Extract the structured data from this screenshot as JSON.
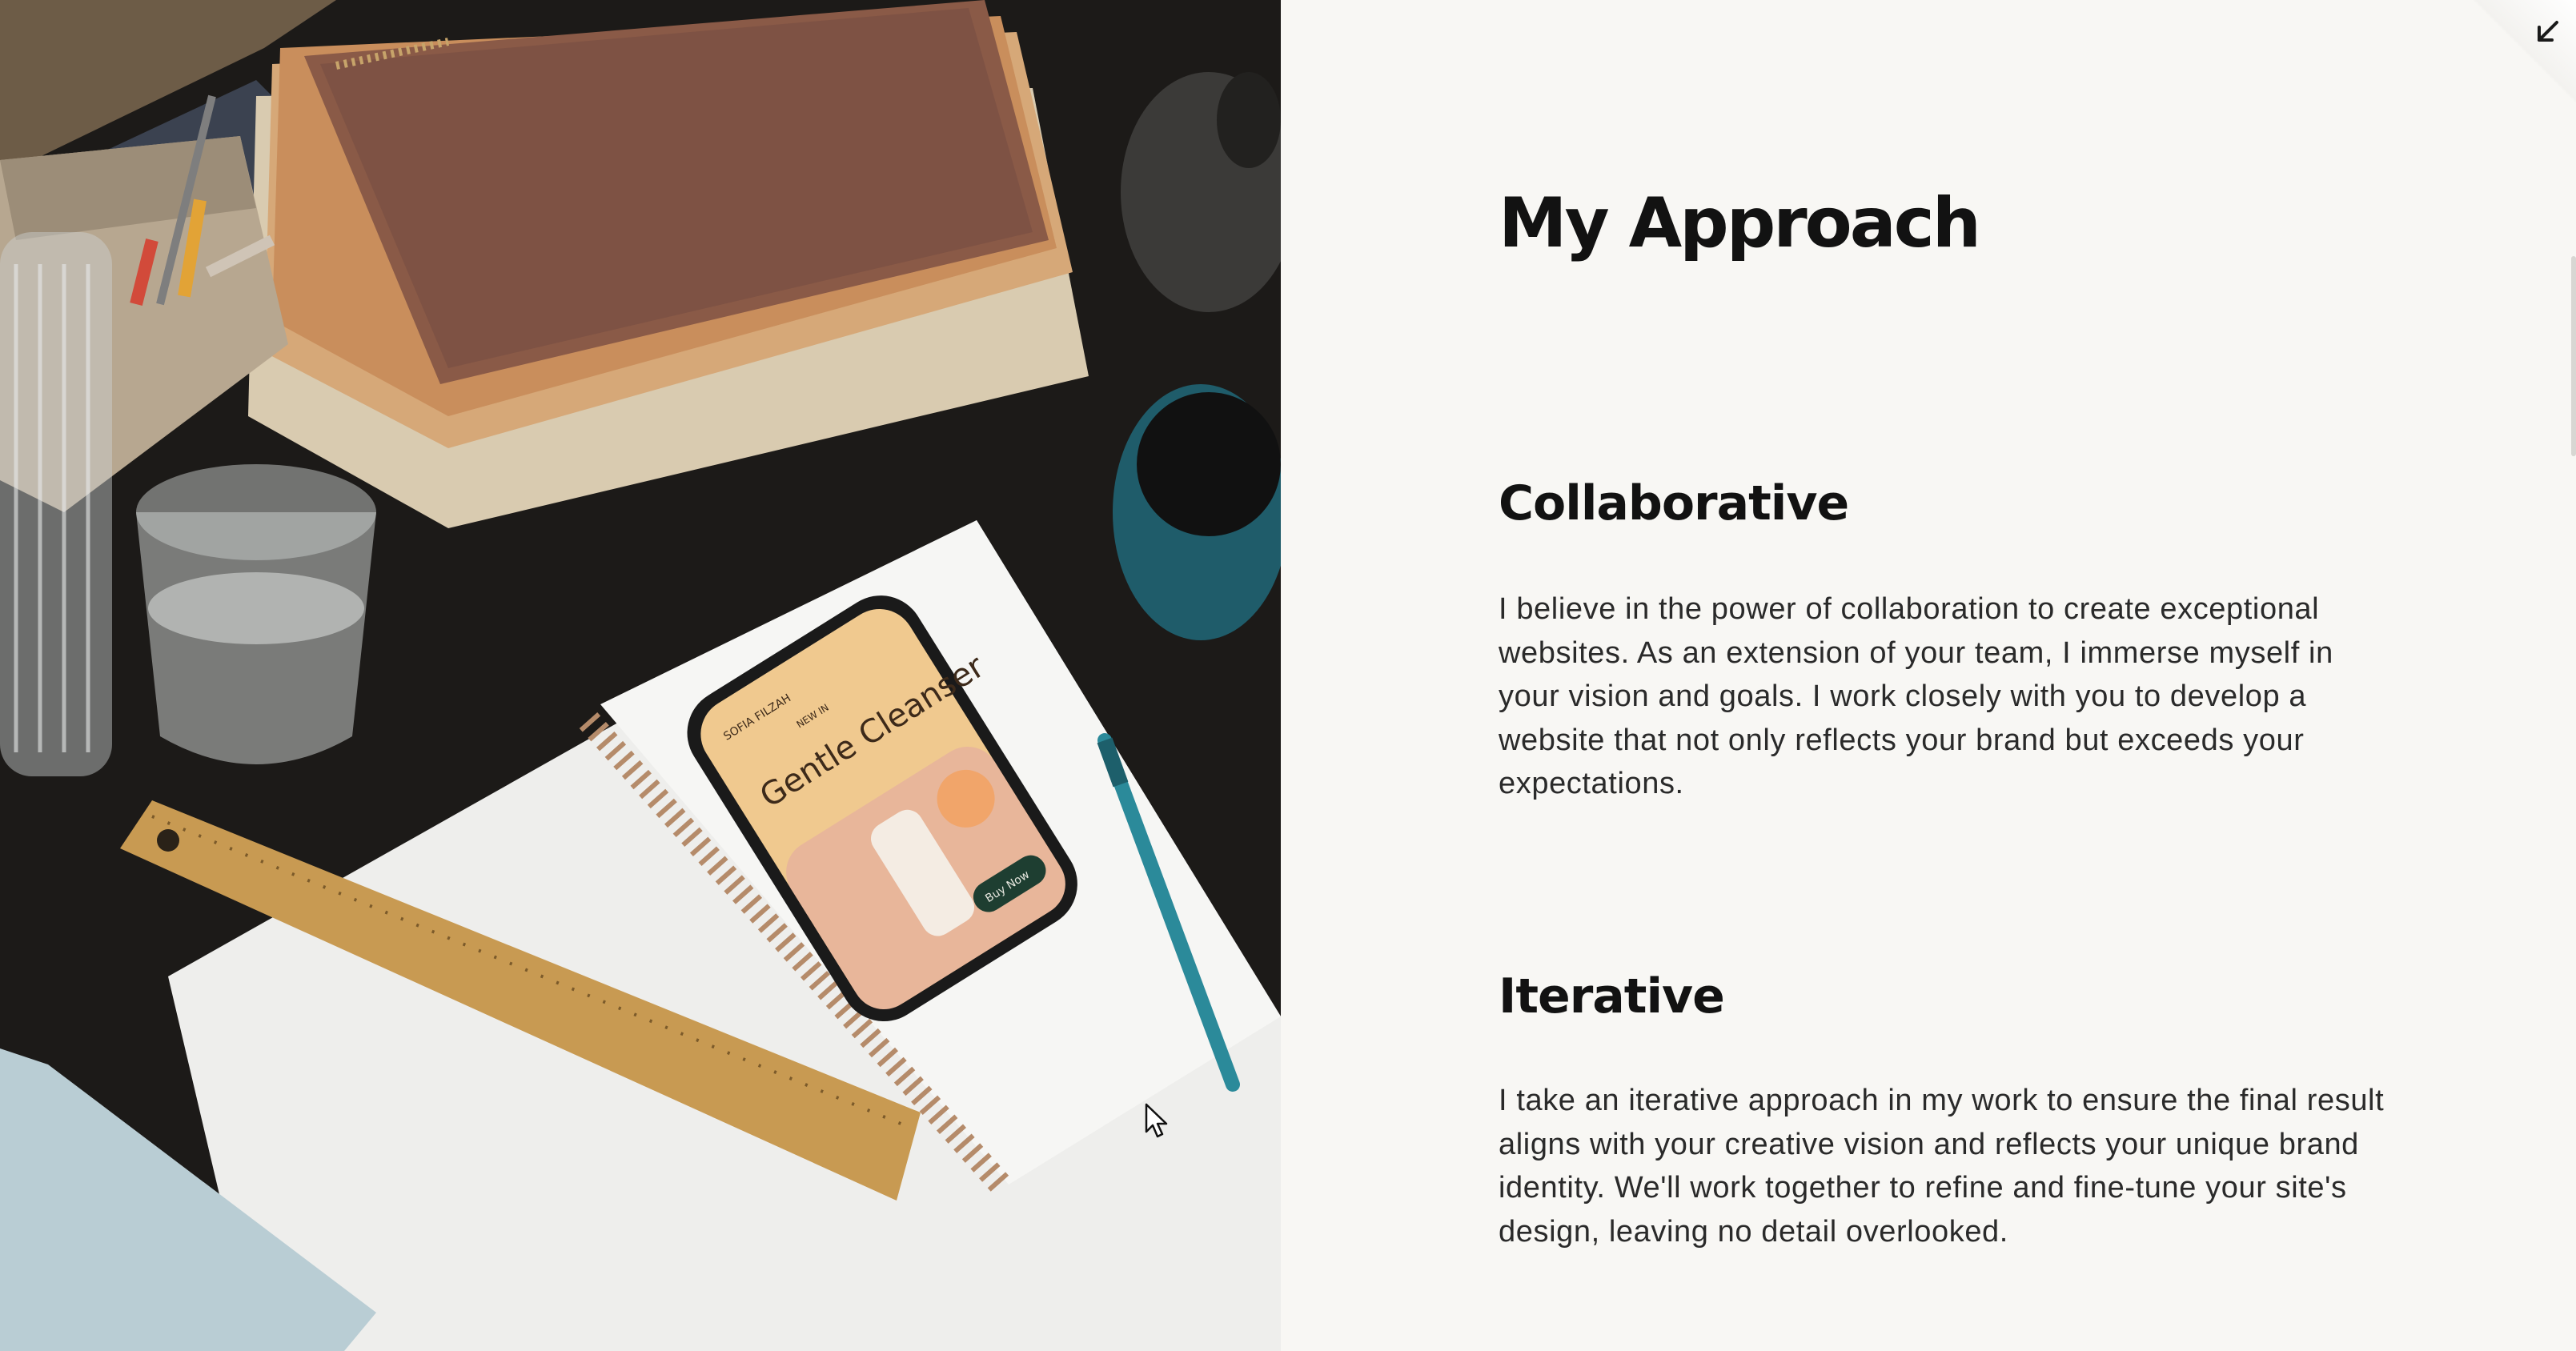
{
  "approach": {
    "title": "My Approach",
    "sections": [
      {
        "title": "Collaborative",
        "body": "I believe in the power of collaboration to create exceptional websites. As an extension of your team, I immerse myself in your vision and goals. I work closely with you to develop a website that not only reflects your brand but exceeds your expectations."
      },
      {
        "title": "Iterative",
        "body": "I take an iterative approach in my work to ensure the final result aligns with your creative vision and reflects your unique brand identity. We'll work together to refine and fine-tune your site's design, leaving no detail overlooked."
      }
    ]
  },
  "photo": {
    "phone_brand": "SOFIA FILZAH",
    "phone_tagline": "NEW IN",
    "phone_product": "Gentle Cleanser",
    "phone_button": "Buy Now"
  },
  "icons": {
    "collapse": "arrow-down-left-icon",
    "cursor": "mouse-pointer-icon"
  },
  "colors": {
    "background": "#f8f7f4",
    "text": "#121212",
    "desk": "#1b1917"
  }
}
